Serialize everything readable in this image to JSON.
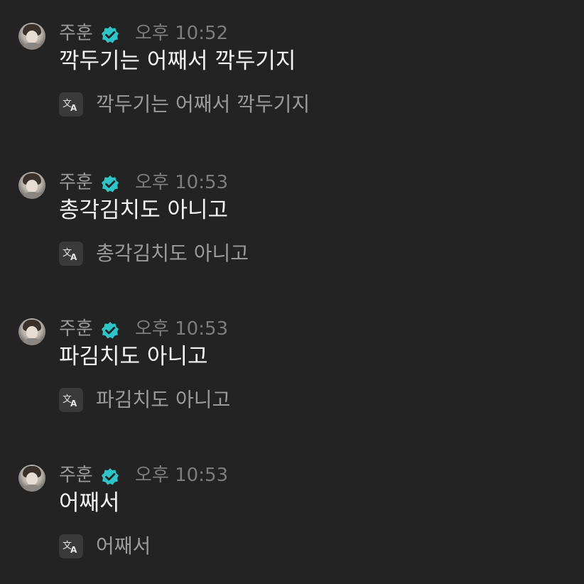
{
  "messages": [
    {
      "user": "주훈",
      "time": "오후 10:52",
      "text": "깍두기는 어째서 깍두기지",
      "translation": "깍두기는 어째서 깍두기지"
    },
    {
      "user": "주훈",
      "time": "오후 10:53",
      "text": "총각김치도 아니고",
      "translation": "총각김치도 아니고"
    },
    {
      "user": "주훈",
      "time": "오후 10:53",
      "text": "파김치도 아니고",
      "translation": "파김치도 아니고"
    },
    {
      "user": "주훈",
      "time": "오후 10:53",
      "text": "어째서",
      "translation": "어째서"
    }
  ],
  "icons": {
    "avatar": "user-avatar",
    "verified": "verified-badge-icon",
    "translate": "translate-icon"
  },
  "colors": {
    "background": "#232323",
    "verified": "#2ec4c8",
    "text": "#f4f4f4",
    "muted": "#9b9b9b"
  }
}
